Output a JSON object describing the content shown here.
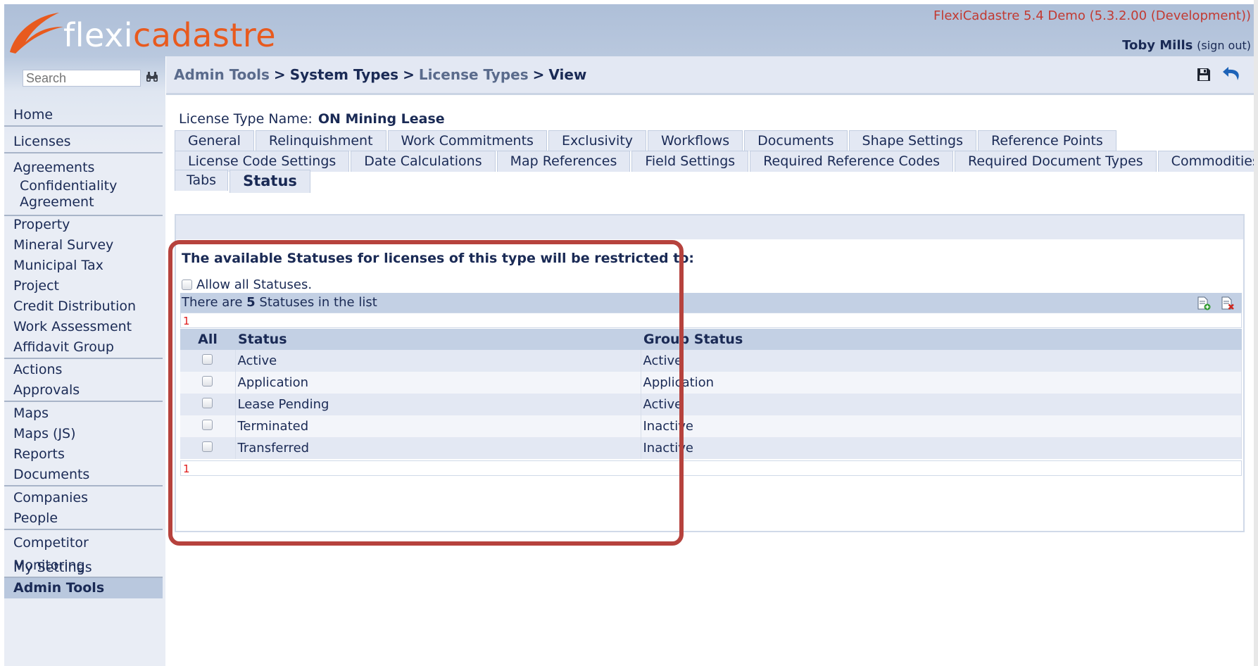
{
  "header": {
    "logo": {
      "flexi": "flexi",
      "cadastre": "cadastre"
    },
    "version": "FlexiCadastre 5.4 Demo (5.3.2.00 (Development))",
    "user_name": "Toby Mills",
    "sign_out": "(sign out)"
  },
  "search": {
    "placeholder": "Search"
  },
  "sidebar": {
    "groups": [
      {
        "items": [
          "Home"
        ]
      },
      {
        "items": [
          "Licenses"
        ]
      },
      {
        "items": [
          "Agreements"
        ],
        "sub": [
          "Confidentiality",
          "Agreement"
        ]
      },
      {
        "items": [
          "Property",
          "Mineral Survey",
          "Municipal Tax",
          "Project",
          "Credit Distribution",
          "Work Assessment",
          "Affidavit Group"
        ]
      },
      {
        "items": [
          "Actions",
          "Approvals"
        ]
      },
      {
        "items": [
          "Maps",
          "Maps (JS)",
          "Reports",
          "Documents"
        ]
      },
      {
        "items": [
          "Companies",
          "People"
        ]
      },
      {
        "items": [
          "Competitor Monitoring"
        ]
      },
      {
        "items": [
          "My Settings",
          "Admin Tools"
        ]
      }
    ]
  },
  "breadcrumb": {
    "items": [
      "Admin Tools",
      "System Types",
      "License Types",
      "View"
    ],
    "sep": ">"
  },
  "license_type": {
    "label": "License Type Name:",
    "value": "ON Mining Lease"
  },
  "tabs": {
    "row1": [
      "General",
      "Relinquishment",
      "Work Commitments",
      "Exclusivity",
      "Workflows",
      "Documents",
      "Shape Settings",
      "Reference Points"
    ],
    "row2": [
      "License Code Settings",
      "Date Calculations",
      "Map References",
      "Field Settings",
      "Required Reference Codes",
      "Required Document Types",
      "Commodities"
    ],
    "row3": [
      "Tabs",
      "Status"
    ],
    "active": "Status"
  },
  "status_panel": {
    "restrict_text": "The available Statuses for licenses of this type will be restricted to:",
    "allow_all_label": "Allow all Statuses.",
    "count_prefix": "There are",
    "count": "5",
    "count_suffix": "Statuses in the list",
    "pager_top": "1",
    "pager_bottom": "1",
    "columns": [
      "All",
      "Status",
      "Group Status"
    ],
    "rows": [
      {
        "status": "Active",
        "group": "Active"
      },
      {
        "status": "Application",
        "group": "Application"
      },
      {
        "status": "Lease Pending",
        "group": "Active"
      },
      {
        "status": "Terminated",
        "group": "Inactive"
      },
      {
        "status": "Transferred",
        "group": "Inactive"
      }
    ]
  },
  "icons": {
    "search": "binoculars-icon",
    "save": "save-icon",
    "undo": "undo-icon",
    "add": "add-item-icon",
    "delete": "delete-item-icon"
  },
  "colors": {
    "version_text": "#c23a32",
    "highlight": "#b6423d",
    "logo_orange": "#e85a1e"
  }
}
